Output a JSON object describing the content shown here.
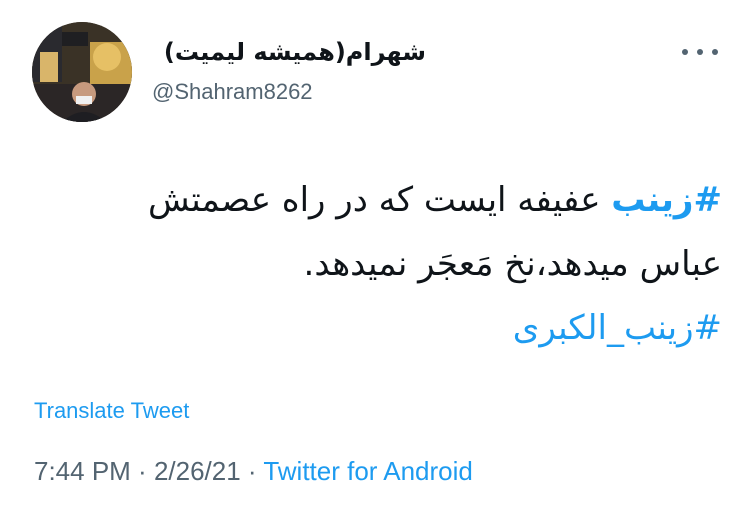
{
  "user": {
    "display_name": "شهرام(همیشه لیمیت)",
    "handle": "@Shahram8262",
    "avatar_icon": "profile-photo"
  },
  "tweet": {
    "hashtag_main": "#زینب",
    "line1_rest": " عفیفه ایست که در راه عصمتش",
    "line2": "عباس میدهد،نخ مَعجَر نمیدهد.",
    "hashtag_second": "#زینب_الکبری"
  },
  "translate_label": "Translate Tweet",
  "meta": {
    "time": "7:44 PM",
    "separator": " · ",
    "date": "2/26/21",
    "source": "Twitter for Android"
  },
  "colors": {
    "accent": "#1d9bf0",
    "secondary_text": "#536471",
    "primary_text": "#0f1419"
  },
  "icons": {
    "more": "more-options-icon"
  }
}
